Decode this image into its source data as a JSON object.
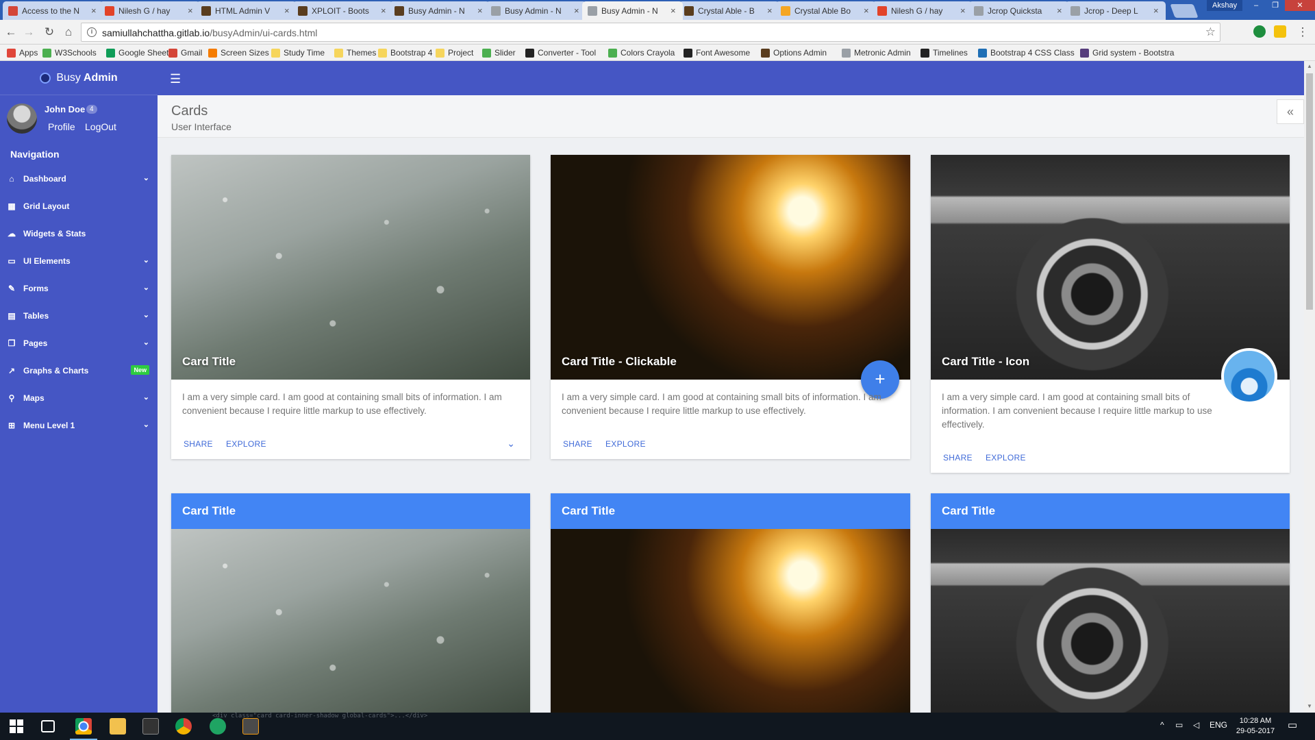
{
  "browser": {
    "tabs": [
      {
        "label": "Access to the N",
        "icon_color": "#d44638"
      },
      {
        "label": "Nilesh G / hay",
        "icon_color": "#e24329"
      },
      {
        "label": "HTML Admin V",
        "icon_color": "#5a3d1e"
      },
      {
        "label": "XPLOIT - Boots",
        "icon_color": "#5a3d1e"
      },
      {
        "label": "Busy Admin - N",
        "icon_color": "#5a3d1e"
      },
      {
        "label": "Busy Admin - N",
        "icon_color": "#9aa0a6"
      },
      {
        "label": "Busy Admin - N",
        "icon_color": "#9aa0a6"
      },
      {
        "label": "Crystal Able - B",
        "icon_color": "#5a3d1e"
      },
      {
        "label": "Crystal Able Bo",
        "icon_color": "#f5a623"
      },
      {
        "label": "Nilesh G / hay",
        "icon_color": "#e24329"
      },
      {
        "label": "Jcrop Quicksta",
        "icon_color": "#9aa0a6"
      },
      {
        "label": "Jcrop - Deep L",
        "icon_color": "#9aa0a6"
      }
    ],
    "profile_name": "Akshay",
    "address": {
      "host": "samiullahchattha.gitlab.io",
      "path": "/busyAdmin/ui-cards.html"
    },
    "bookmarks": [
      {
        "label": "Apps",
        "icon_color": "#e0463a"
      },
      {
        "label": "W3Schools",
        "icon_color": "#4caf50"
      },
      {
        "label": "Google Sheets",
        "icon_color": "#0f9d58"
      },
      {
        "label": "Gmail",
        "icon_color": "#d44638"
      },
      {
        "label": "Screen Sizes",
        "icon_color": "#f57c00"
      },
      {
        "label": "Study Time",
        "icon_color": "#f6d55c"
      },
      {
        "label": "Themes",
        "icon_color": "#f6d55c"
      },
      {
        "label": "Bootstrap 4",
        "icon_color": "#f6d55c"
      },
      {
        "label": "Project",
        "icon_color": "#f6d55c"
      },
      {
        "label": "Slider",
        "icon_color": "#4caf50"
      },
      {
        "label": "Converter - Tool",
        "icon_color": "#222222"
      },
      {
        "label": "Colors Crayola",
        "icon_color": "#4caf50"
      },
      {
        "label": "Font Awesome",
        "icon_color": "#222222"
      },
      {
        "label": "Options Admin",
        "icon_color": "#5a3d1e"
      },
      {
        "label": "Metronic Admin",
        "icon_color": "#9aa0a6"
      },
      {
        "label": "Timelines",
        "icon_color": "#222222"
      },
      {
        "label": "Bootstrap 4 CSS Class",
        "icon_color": "#1f6fb5"
      },
      {
        "label": "Grid system - Bootstra",
        "icon_color": "#563d7c"
      }
    ]
  },
  "sidebar": {
    "brand_prefix": "Busy",
    "brand_bold": "Admin",
    "user": {
      "name": "John Doe",
      "badge": "4",
      "profile_link": "Profile",
      "logout_link": "LogOut"
    },
    "nav_heading": "Navigation",
    "items": [
      {
        "label": "Dashboard",
        "icon": "home-icon",
        "glyph": "⌂",
        "has_chevron": true
      },
      {
        "label": "Grid Layout",
        "icon": "grid-icon",
        "glyph": "▦",
        "has_chevron": false
      },
      {
        "label": "Widgets & Stats",
        "icon": "cloud-icon",
        "glyph": "☁",
        "has_chevron": false
      },
      {
        "label": "UI Elements",
        "icon": "desktop-icon",
        "glyph": "▭",
        "has_chevron": true
      },
      {
        "label": "Forms",
        "icon": "edit-icon",
        "glyph": "✎",
        "has_chevron": true
      },
      {
        "label": "Tables",
        "icon": "table-icon",
        "glyph": "▤",
        "has_chevron": true
      },
      {
        "label": "Pages",
        "icon": "pages-icon",
        "glyph": "❐",
        "has_chevron": true
      },
      {
        "label": "Graphs & Charts",
        "icon": "chart-icon",
        "glyph": "↗",
        "badge": "New"
      },
      {
        "label": "Maps",
        "icon": "map-marker-icon",
        "glyph": "⚲",
        "has_chevron": true
      },
      {
        "label": "Menu Level 1",
        "icon": "sitemap-icon",
        "glyph": "⊞",
        "has_chevron": true
      }
    ]
  },
  "header": {
    "title": "Cards",
    "subtitle": "User Interface"
  },
  "cards": [
    {
      "title": "Card Title",
      "text": "I am a very simple card. I am good at containing small bits of information. I am convenient because I require little markup to use effectively.",
      "action1": "SHARE",
      "action2": "EXPLORE"
    },
    {
      "title": "Card Title - Clickable",
      "text": "I am a very simple card. I am good at containing small bits of information. I am convenient because I require little markup to use effectively.",
      "action1": "SHARE",
      "action2": "EXPLORE",
      "fab": "+"
    },
    {
      "title": "Card Title - Icon",
      "text": "I am a very simple card. I am good at containing small bits of information. I am convenient because I require little markup to use effectively.",
      "action1": "SHARE",
      "action2": "EXPLORE"
    }
  ],
  "cards_row2": [
    {
      "title": "Card Title"
    },
    {
      "title": "Card Title"
    },
    {
      "title": "Card Title"
    }
  ],
  "taskbar": {
    "code_snippet": "<div class=\"card card-inner-shadow global-cards\">...</div>",
    "language": "ENG",
    "time": "10:28 AM",
    "date": "29-05-2017"
  },
  "colors": {
    "sidebar": "#4556c4",
    "accent": "#3f6ad8",
    "card_header": "#4285f4",
    "fab": "#3f7fe9"
  }
}
